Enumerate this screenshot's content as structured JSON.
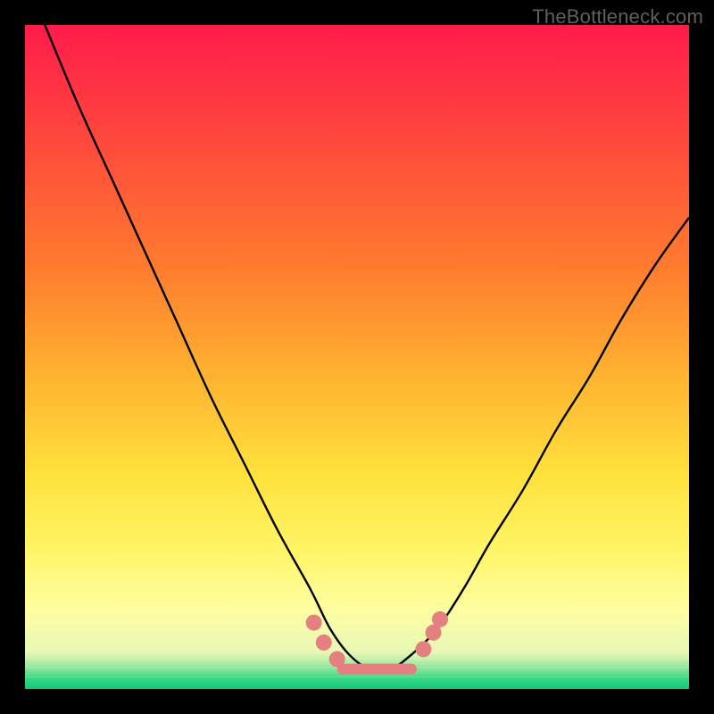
{
  "watermark": "TheBottleneck.com",
  "gradient": {
    "stops": [
      {
        "offset": 0.0,
        "color": "#ff1b4b"
      },
      {
        "offset": 0.18,
        "color": "#ff4a3b"
      },
      {
        "offset": 0.36,
        "color": "#ff7a2f"
      },
      {
        "offset": 0.52,
        "color": "#ffb030"
      },
      {
        "offset": 0.68,
        "color": "#ffe23d"
      },
      {
        "offset": 0.8,
        "color": "#fff66a"
      },
      {
        "offset": 0.88,
        "color": "#fefea0"
      },
      {
        "offset": 0.945,
        "color": "#e8f7b5"
      },
      {
        "offset": 0.965,
        "color": "#9fe8a0"
      },
      {
        "offset": 0.985,
        "color": "#33d885"
      },
      {
        "offset": 1.0,
        "color": "#15c778"
      }
    ]
  },
  "chart_data": {
    "type": "line",
    "title": "",
    "xlabel": "",
    "ylabel": "",
    "xlim": [
      0,
      100
    ],
    "ylim": [
      0,
      100
    ],
    "series": [
      {
        "name": "bottleneck-curve",
        "x": [
          3,
          8,
          13,
          18,
          23,
          28,
          33,
          38,
          43,
          46,
          49,
          52,
          55,
          58,
          62,
          66,
          70,
          75,
          80,
          85,
          90,
          95,
          100
        ],
        "values": [
          100,
          88,
          77,
          66,
          55,
          44,
          34,
          24,
          15,
          9,
          5,
          3,
          3,
          5,
          9,
          15,
          22,
          30,
          39,
          47,
          56,
          64,
          71
        ]
      }
    ],
    "markers": {
      "name": "highlight-dots",
      "color": "#e48080",
      "points": [
        {
          "x": 43.5,
          "y": 10.0
        },
        {
          "x": 45.0,
          "y": 7.0
        },
        {
          "x": 47.0,
          "y": 4.5
        },
        {
          "x": 60.0,
          "y": 6.0
        },
        {
          "x": 61.5,
          "y": 8.5
        },
        {
          "x": 62.5,
          "y": 10.5
        }
      ]
    },
    "flat_segment": {
      "name": "trough-bar",
      "color": "#e48080",
      "x_start": 47.0,
      "x_end": 59.0,
      "y": 3.0
    }
  }
}
